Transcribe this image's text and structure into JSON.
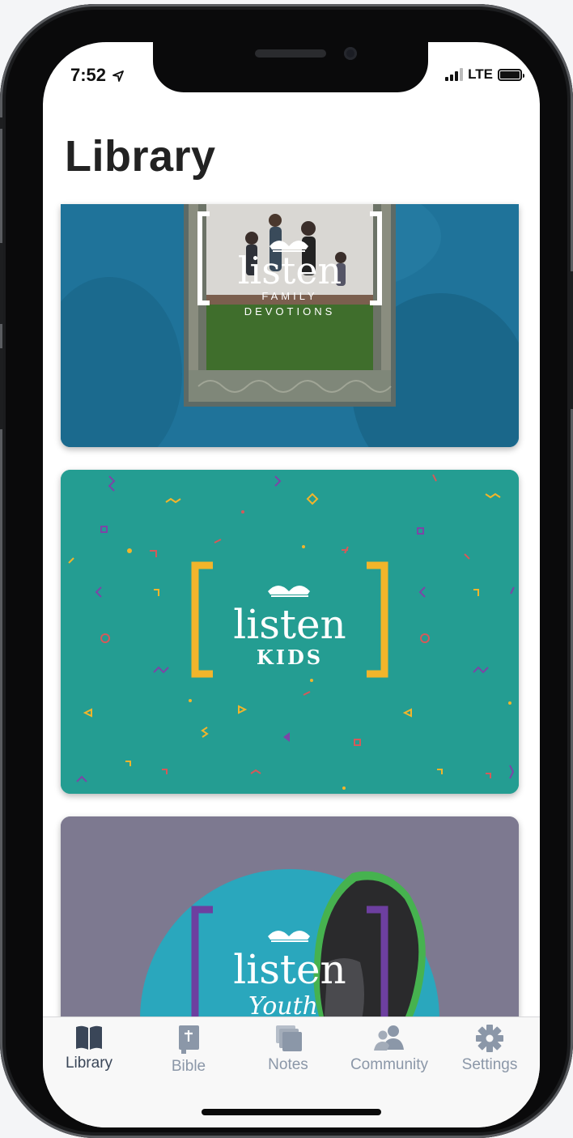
{
  "status_bar": {
    "time": "7:52",
    "network": "LTE"
  },
  "header": {
    "title": "Library"
  },
  "library": {
    "items": [
      {
        "title_script": "listen",
        "subtitle": "FAMILY\nDEVOTIONS",
        "line1": "FAMILY",
        "line2": "DEVOTIONS",
        "bg_color": "#1f739a"
      },
      {
        "title_script": "listen",
        "subtitle": "KIDS",
        "bg_color": "#249d92",
        "bracket_color": "#f2b52b"
      },
      {
        "title_script": "listen",
        "subtitle": "Youth",
        "bg_color": "#7d7990",
        "bracket_color": "#6d3fa0",
        "circle_color": "#2aa7bd"
      }
    ]
  },
  "tab_bar": {
    "tabs": [
      {
        "label": "Library",
        "icon": "book-open-icon",
        "active": true
      },
      {
        "label": "Bible",
        "icon": "bible-icon",
        "active": false
      },
      {
        "label": "Notes",
        "icon": "notes-stack-icon",
        "active": false
      },
      {
        "label": "Community",
        "icon": "people-icon",
        "active": false
      },
      {
        "label": "Settings",
        "icon": "gear-icon",
        "active": false
      }
    ]
  },
  "colors": {
    "tab_active": "#3a4658",
    "tab_inactive": "#8b97a8",
    "title": "#222222"
  }
}
